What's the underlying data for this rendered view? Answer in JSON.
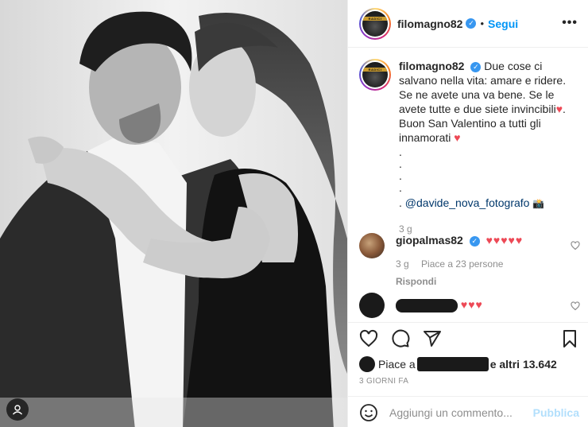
{
  "post": {
    "photo_alt": "",
    "username": "filomagno82",
    "follow_label": "Segui",
    "dot": "•",
    "more": "•••"
  },
  "caption": {
    "username": "filomagno82",
    "text": "Due cose ci salvano nella vita: amare e ridere. Se ne avete una va bene. Se le avete tutte e due siete invincibili",
    "text2": ". Buon San Valentino a tutti gli innamorati ",
    "heart": "♥",
    "dots": ".\n.\n.\n.",
    "mention_prefix": ". ",
    "mention": "@davide_nova_fotografo",
    "camera": "📸",
    "time": "3 g"
  },
  "comments": [
    {
      "username": "giopalmas82",
      "text": "♥♥♥♥♥",
      "time": "3 g",
      "likes": "Piace a 23 persone",
      "reply": "Rispondi"
    },
    {
      "username": "",
      "text": "♥♥♥"
    }
  ],
  "actions": {
    "likes_prefix": "Piace a",
    "likes_suffix": "e altri 13.642",
    "ago": "3 GIORNI FA"
  },
  "comment_box": {
    "placeholder": "Aggiungi un commento...",
    "publish": "Pubblica"
  },
  "colors": {
    "accent": "#0095f6",
    "heart": "#ed4956",
    "muted": "#8e8e8e",
    "publish_disabled": "#b2dffc"
  },
  "icons": [
    "heart-icon",
    "comment-icon",
    "share-icon",
    "bookmark-icon",
    "emoji-icon",
    "more-icon",
    "verified-icon"
  ]
}
